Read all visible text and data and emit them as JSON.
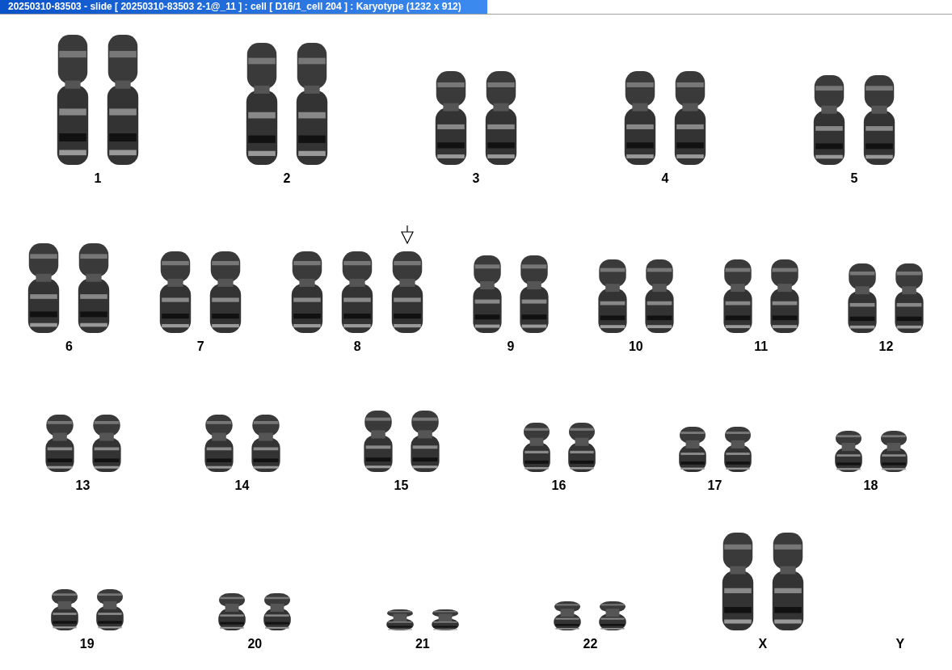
{
  "window": {
    "title": "20250310-83503 - slide [ 20250310-83503 2-1@_11 ] : cell [ D16/1_cell 204 ] : Karyotype  (1232 x 912)"
  },
  "rows": [
    {
      "groups": [
        {
          "label": "1",
          "chromosomes": [
            {
              "marked": false
            },
            {
              "marked": false
            }
          ]
        },
        {
          "label": "2",
          "chromosomes": [
            {
              "marked": false
            },
            {
              "marked": false
            }
          ]
        },
        {
          "label": "3",
          "chromosomes": [
            {
              "marked": false
            },
            {
              "marked": false
            }
          ]
        },
        {
          "label": "4",
          "chromosomes": [
            {
              "marked": false
            },
            {
              "marked": false
            }
          ]
        },
        {
          "label": "5",
          "chromosomes": [
            {
              "marked": false
            },
            {
              "marked": false
            }
          ]
        }
      ]
    },
    {
      "groups": [
        {
          "label": "6",
          "chromosomes": [
            {
              "marked": false
            },
            {
              "marked": false
            }
          ]
        },
        {
          "label": "7",
          "chromosomes": [
            {
              "marked": false
            },
            {
              "marked": false
            }
          ]
        },
        {
          "label": "8",
          "chromosomes": [
            {
              "marked": false
            },
            {
              "marked": false
            },
            {
              "marked": true
            }
          ]
        },
        {
          "label": "9",
          "chromosomes": [
            {
              "marked": false
            },
            {
              "marked": false
            }
          ]
        },
        {
          "label": "10",
          "chromosomes": [
            {
              "marked": false
            },
            {
              "marked": false
            }
          ]
        },
        {
          "label": "11",
          "chromosomes": [
            {
              "marked": false
            },
            {
              "marked": false
            }
          ]
        },
        {
          "label": "12",
          "chromosomes": [
            {
              "marked": false
            },
            {
              "marked": false
            }
          ]
        }
      ]
    },
    {
      "groups": [
        {
          "label": "13",
          "chromosomes": [
            {
              "marked": false
            },
            {
              "marked": false
            }
          ]
        },
        {
          "label": "14",
          "chromosomes": [
            {
              "marked": false
            },
            {
              "marked": false
            }
          ]
        },
        {
          "label": "15",
          "chromosomes": [
            {
              "marked": false
            },
            {
              "marked": false
            }
          ]
        },
        {
          "label": "16",
          "chromosomes": [
            {
              "marked": false
            },
            {
              "marked": false
            }
          ]
        },
        {
          "label": "17",
          "chromosomes": [
            {
              "marked": false
            },
            {
              "marked": false
            }
          ]
        },
        {
          "label": "18",
          "chromosomes": [
            {
              "marked": false
            },
            {
              "marked": false
            }
          ]
        }
      ]
    },
    {
      "groups": [
        {
          "label": "19",
          "chromosomes": [
            {
              "marked": false
            },
            {
              "marked": false
            }
          ]
        },
        {
          "label": "20",
          "chromosomes": [
            {
              "marked": false
            },
            {
              "marked": false
            }
          ]
        },
        {
          "label": "21",
          "chromosomes": [
            {
              "marked": false
            },
            {
              "marked": false
            }
          ]
        },
        {
          "label": "22",
          "chromosomes": [
            {
              "marked": false
            },
            {
              "marked": false
            }
          ]
        },
        {
          "label": "X",
          "chromosomes": [
            {
              "marked": false
            },
            {
              "marked": false
            }
          ]
        },
        {
          "label": "Y"
        }
      ]
    }
  ]
}
